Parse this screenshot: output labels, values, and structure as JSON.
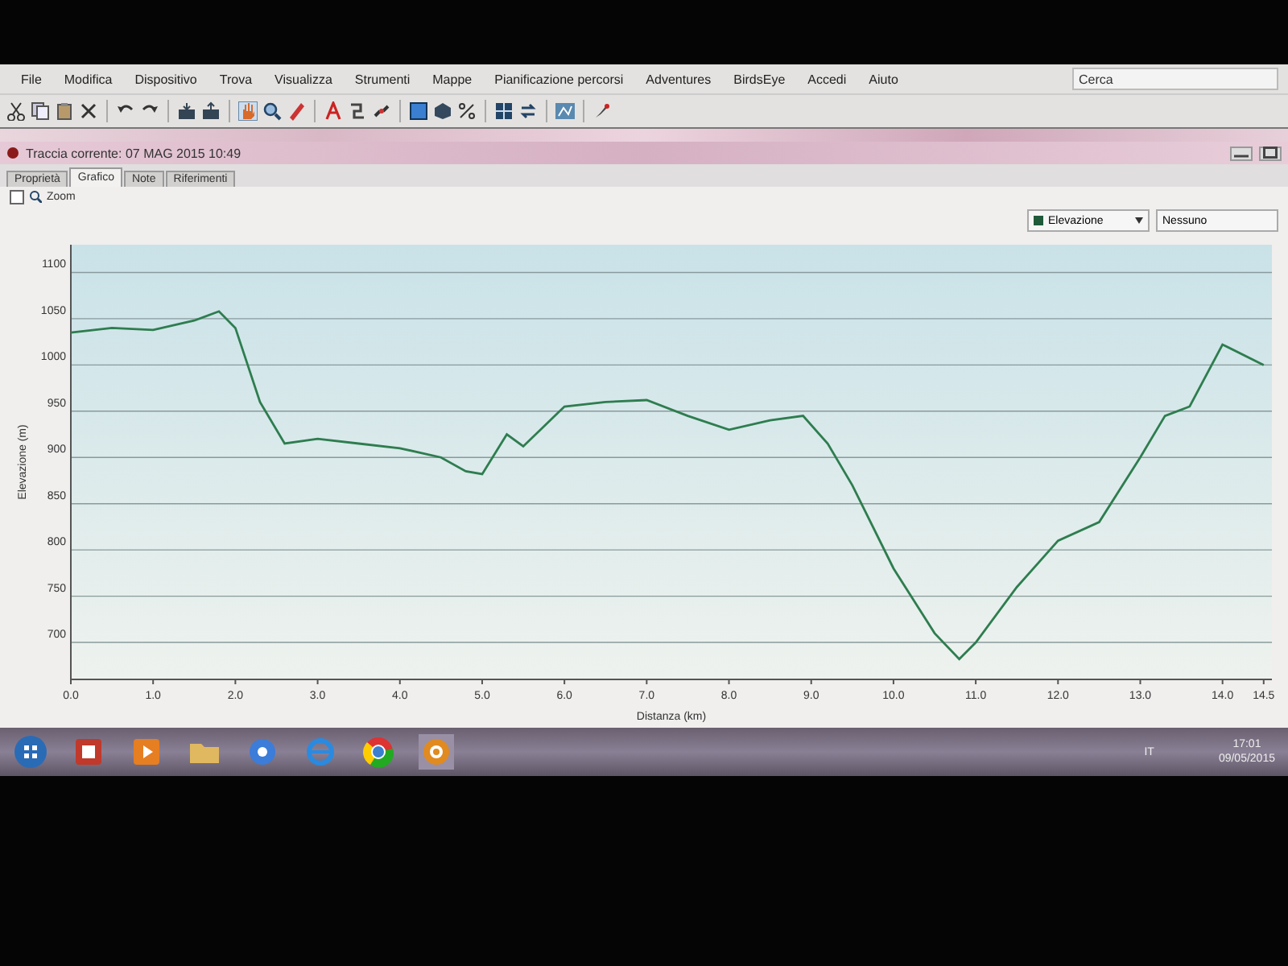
{
  "menu_bar": {
    "items": [
      "File",
      "Modifica",
      "Dispositivo",
      "Trova",
      "Visualizza",
      "Strumenti",
      "Mappe",
      "Pianificazione percorsi",
      "Adventures",
      "BirdsEye",
      "Accedi",
      "Aiuto"
    ],
    "search": {
      "placeholder": "Cerca"
    }
  },
  "document": {
    "title": "Traccia corrente: 07 MAG 2015 10:49"
  },
  "tabs": [
    {
      "label": "Proprietà",
      "selected": false
    },
    {
      "label": "Grafico",
      "selected": true
    },
    {
      "label": "Note",
      "selected": false
    },
    {
      "label": "Riferimenti",
      "selected": false
    }
  ],
  "zoom": {
    "label": "Zoom",
    "checked": false
  },
  "dropdowns": [
    {
      "value": "Elevazione",
      "color": "#1f5a3a"
    },
    {
      "value": "Nessuno"
    }
  ],
  "chart": {
    "chart_data": {
      "type": "line",
      "xlabel": "Distanza  (km)",
      "ylabel": "Elevazione (m)",
      "x": [
        0,
        0.5,
        1.0,
        1.5,
        1.8,
        2.0,
        2.3,
        2.6,
        3.0,
        3.5,
        4.0,
        4.5,
        4.8,
        5.0,
        5.3,
        5.5,
        6.0,
        6.5,
        7.0,
        7.5,
        8.0,
        8.5,
        8.9,
        9.2,
        9.5,
        10.0,
        10.5,
        10.8,
        11.0,
        11.5,
        12.0,
        12.5,
        13.0,
        13.3,
        13.6,
        14.0,
        14.5
      ],
      "grid": true,
      "series": [
        {
          "color": "#2e7d4f",
          "values": [
            1035,
            1040,
            1038,
            1048,
            1058,
            1040,
            960,
            915,
            920,
            915,
            910,
            900,
            885,
            882,
            925,
            912,
            955,
            960,
            962,
            945,
            930,
            940,
            945,
            915,
            870,
            780,
            710,
            682,
            700,
            760,
            810,
            830,
            900,
            945,
            955,
            1022,
            1000
          ]
        }
      ],
      "xlim": [
        0,
        14.6
      ],
      "ylim": [
        660,
        1130
      ],
      "xticks": [
        {
          "value": 0,
          "label": "0.0"
        },
        {
          "value": 1,
          "label": "1.0"
        },
        {
          "value": 2,
          "label": "2.0"
        },
        {
          "value": 3,
          "label": "3.0"
        },
        {
          "value": 4,
          "label": "4.0"
        },
        {
          "value": 5,
          "label": "5.0"
        },
        {
          "value": 6,
          "label": "6.0"
        },
        {
          "value": 7,
          "label": "7.0"
        },
        {
          "value": 8,
          "label": "8.0"
        },
        {
          "value": 9,
          "label": "9.0"
        },
        {
          "value": 10,
          "label": "10.0"
        },
        {
          "value": 11,
          "label": "11.0"
        },
        {
          "value": 12,
          "label": "12.0"
        },
        {
          "value": 13,
          "label": "13.0"
        },
        {
          "value": 14,
          "label": "14.0"
        },
        {
          "value": 14.5,
          "label": "14.5"
        }
      ],
      "yticks": [
        700,
        750,
        800,
        850,
        900,
        950,
        1000,
        1050,
        1100
      ]
    }
  },
  "taskbar": {
    "language": "IT",
    "time": "17:01",
    "date": "09/05/2015"
  }
}
